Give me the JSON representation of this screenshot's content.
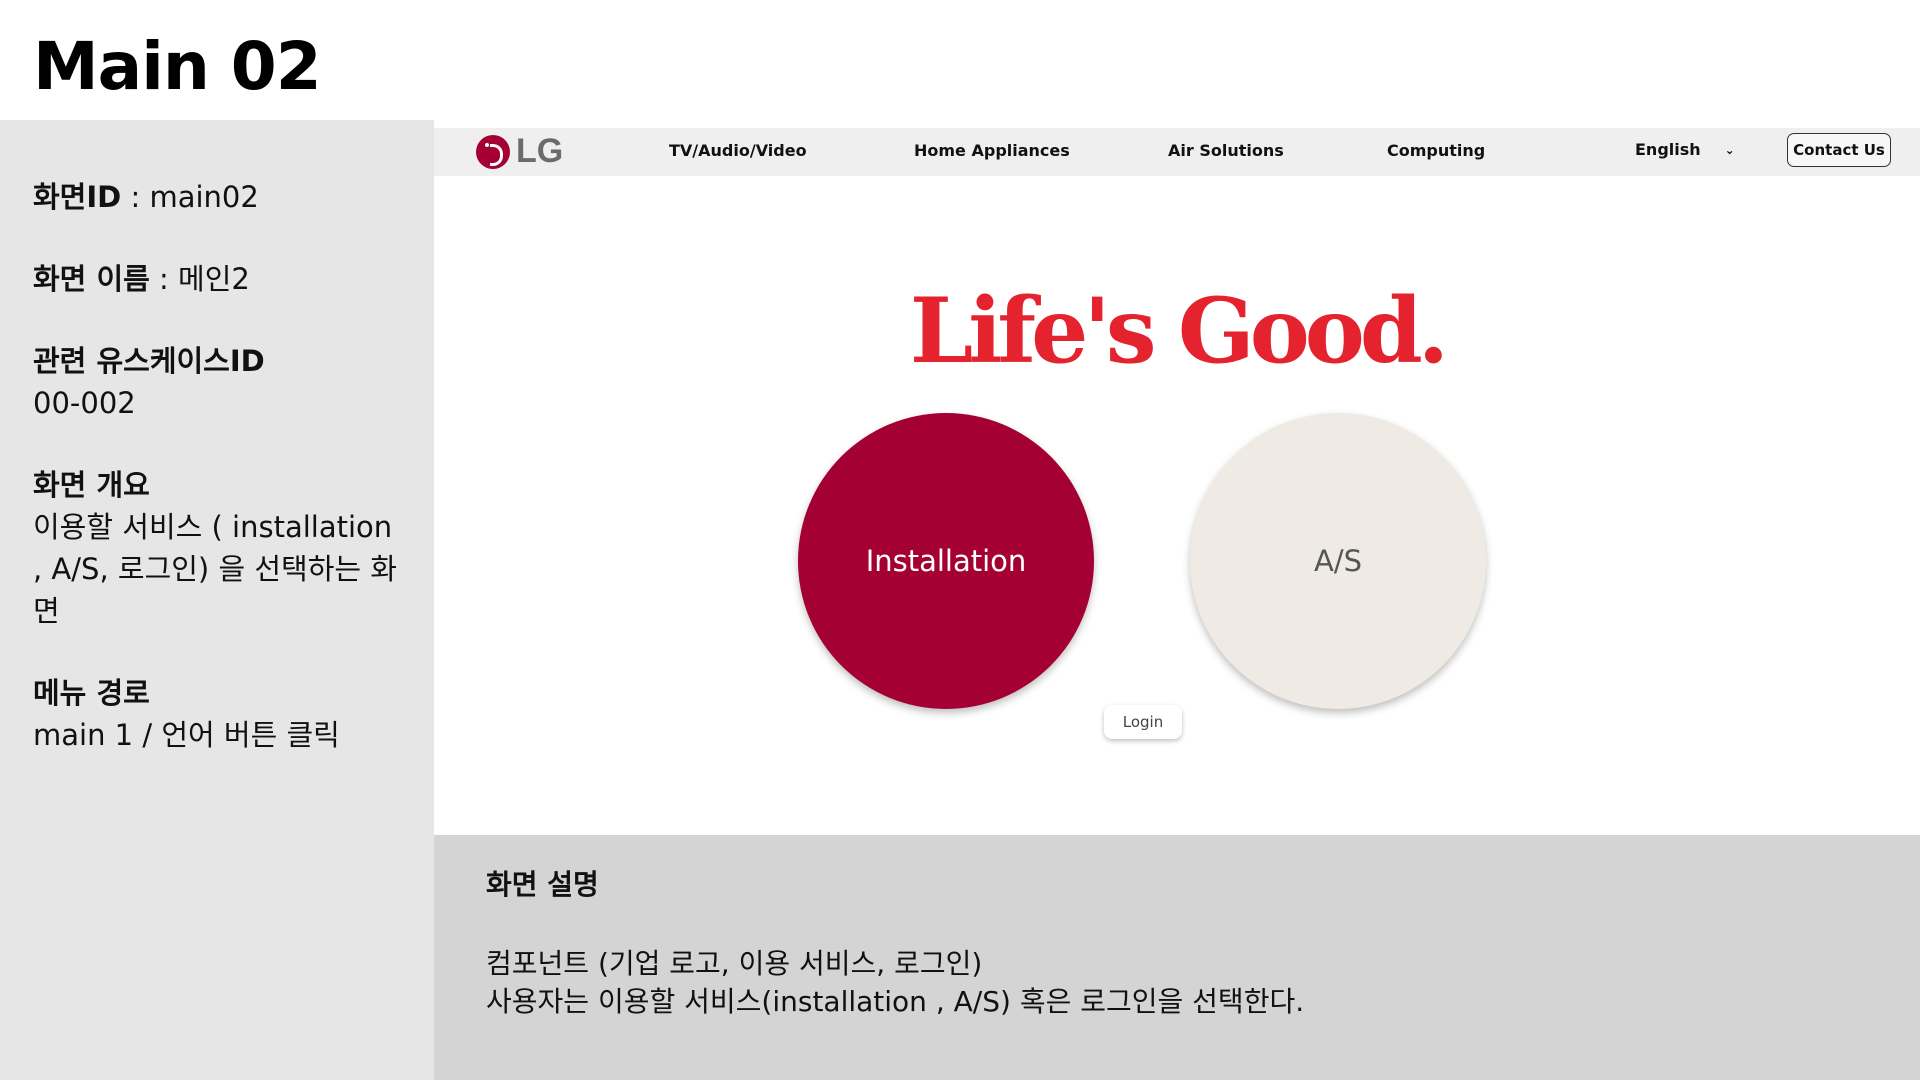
{
  "doc": {
    "title": "Main 02"
  },
  "spec": {
    "screen_id_label": "화면ID",
    "screen_id_value": " : main02",
    "screen_name_label": "화면 이름",
    "screen_name_value": " : 메인2",
    "usecase_label": "관련 유스케이스ID",
    "usecase_value": "00-002",
    "overview_label": "화면 개요",
    "overview_value": "이용할 서비스 ( installation , A/S, 로그인) 을 선택하는 화면",
    "menu_path_label": "메뉴 경로",
    "menu_path_value": "main 1  / 언어 버튼 클릭"
  },
  "nav": {
    "logo_text": "LG",
    "items": [
      "TV/Audio/Video",
      "Home Appliances",
      "Air Solutions",
      "Computing"
    ],
    "language": "English",
    "contact": "Contact Us"
  },
  "hero": {
    "slogan": "Life's Good.",
    "installation": "Installation",
    "as": "A/S",
    "login": "Login"
  },
  "description": {
    "title": "화면 설명",
    "line1": "컴포넌트 (기업 로고, 이용 서비스, 로그인)",
    "line2": "사용자는 이용할 서비스(installation , A/S) 혹은 로그인을 선택한다."
  },
  "colors": {
    "brand": "#a50034",
    "slogan": "#e4232e",
    "as_circle": "#efebe4"
  }
}
